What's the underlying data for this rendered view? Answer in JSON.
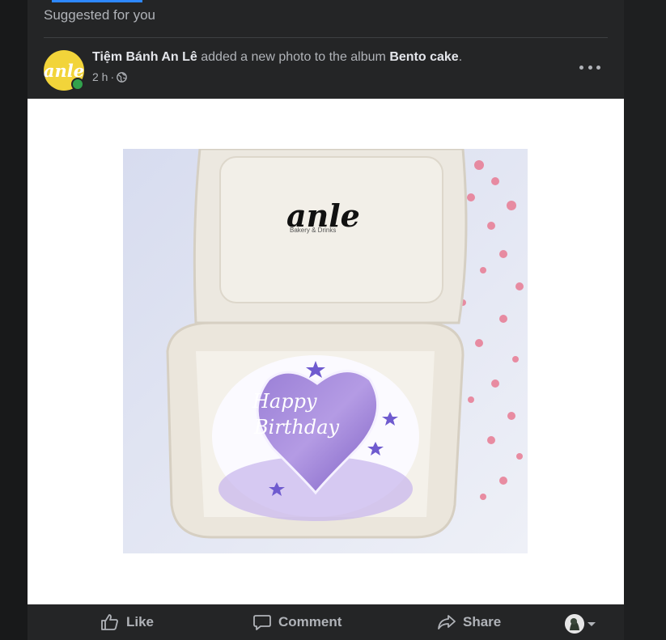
{
  "feed": {
    "section_label": "Suggested for you",
    "post": {
      "page_name": "Tiệm Bánh An Lê",
      "action_text": " added a new photo to the album ",
      "album_name": "Bento cake",
      "punctuation": ".",
      "time": "2 h",
      "separator": "·",
      "audience_icon": "globe-icon",
      "avatar_logo_text": "anle",
      "photo": {
        "box_logo": "anle",
        "box_logo_sub": "Bakery & Drinks",
        "cake_text_line1": "Happy",
        "cake_text_line2": "Birthday"
      }
    },
    "actions": {
      "like": "Like",
      "comment": "Comment",
      "share": "Share"
    }
  },
  "colors": {
    "background": "#18191a",
    "card": "#242526",
    "text_primary": "#e4e6eb",
    "text_secondary": "#b0b3b8",
    "accent": "#2d88ff",
    "online": "#31a24c",
    "avatar_yellow": "#f2d43a"
  }
}
